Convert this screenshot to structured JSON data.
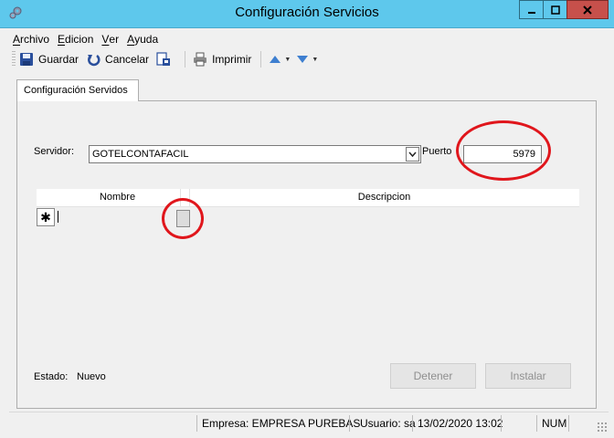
{
  "window": {
    "title": "Configuración Servicios",
    "titlebar_color": "#5ec8ec",
    "close_color": "#c7504b"
  },
  "menu": [
    {
      "accel": "A",
      "rest": "rchivo"
    },
    {
      "accel": "E",
      "rest": "dicion"
    },
    {
      "accel": "V",
      "rest": "er"
    },
    {
      "accel": "A",
      "rest": "yuda"
    }
  ],
  "toolbar": {
    "save_label": "Guardar",
    "cancel_label": "Cancelar",
    "print_label": "Imprimir"
  },
  "tab": {
    "label": "Configuración Servidos"
  },
  "form": {
    "server_label": "Servidor:",
    "server_value": "GOTELCONTAFACIL",
    "port_label": "Puerto",
    "port_value": "5979"
  },
  "grid": {
    "columns": [
      "Nombre",
      "Descripcion"
    ],
    "new_row_marker": "✱"
  },
  "status": {
    "label": "Estado:",
    "value": "Nuevo"
  },
  "buttons": {
    "stop_label": "Detener",
    "install_label": "Instalar"
  },
  "statusbar": {
    "empresa": "Empresa: EMPRESA PUREBAS",
    "usuario": "Usuario: sa",
    "datetime": "13/02/2020 13:02",
    "num": "NUM"
  },
  "annotations": {
    "ring_color": "#e0161c"
  }
}
